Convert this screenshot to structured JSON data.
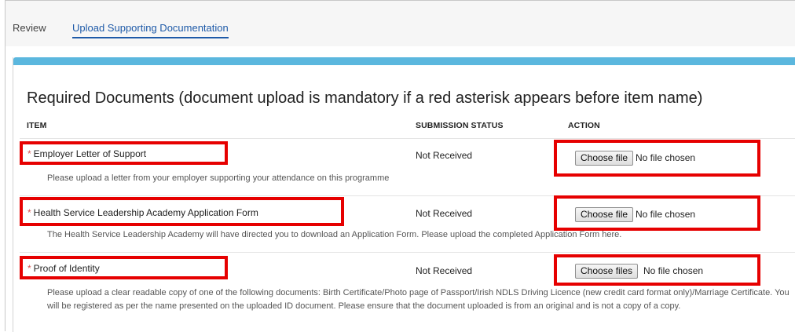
{
  "tabs": [
    {
      "label": "Review",
      "active": false
    },
    {
      "label": "Upload Supporting Documentation",
      "active": true
    }
  ],
  "section": {
    "title": "Required Documents (document upload is mandatory if a red asterisk appears before item name)"
  },
  "table": {
    "headers": {
      "item": "ITEM",
      "status": "SUBMISSION STATUS",
      "action": "ACTION"
    },
    "rows": [
      {
        "asterisk": "*",
        "name": "Employer Letter of Support",
        "status": "Not Received",
        "button_label": "Choose file",
        "file_text": "No file chosen",
        "description": "Please upload a letter from your employer supporting your attendance on this programme"
      },
      {
        "asterisk": "*",
        "name": "Health Service Leadership Academy Application Form",
        "status": "Not Received",
        "button_label": "Choose file",
        "file_text": "No file chosen",
        "description": "The Health Service Leadership Academy will have directed you to download an Application Form. Please upload the completed Application Form here."
      },
      {
        "asterisk": "*",
        "name": "Proof of Identity",
        "status": "Not Received",
        "button_label": "Choose files",
        "file_text": "No file chosen",
        "description": "Please upload a clear readable copy of one of the following documents: Birth Certificate/Photo page of Passport/Irish NDLS Driving Licence (new credit card format only)/Marriage Certificate. You will be registered as per the name presented on the uploaded ID document. Please ensure that the document uploaded is from an original and is not a copy of a copy."
      }
    ]
  },
  "colors": {
    "accent_bar": "#5bb7de",
    "active_tab": "#1e5aa8",
    "highlight_border": "#e60000",
    "asterisk": "#d9534f"
  }
}
